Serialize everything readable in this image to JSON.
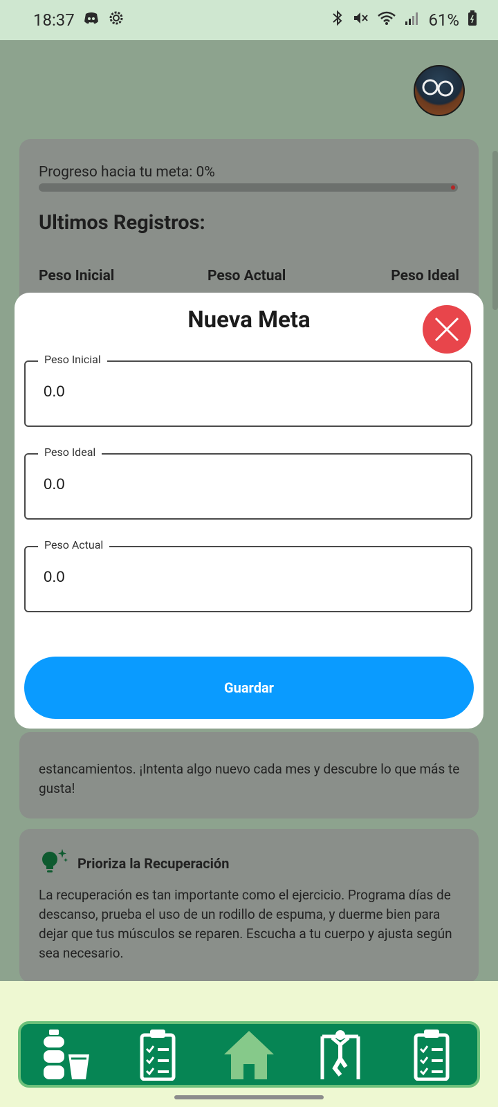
{
  "status_bar": {
    "time": "18:37",
    "battery": "61%"
  },
  "progress": {
    "label": "Progreso hacia tu meta: 0%",
    "value": 0
  },
  "records": {
    "title": "Ultimos Registros:",
    "columns": [
      "Peso Inicial",
      "Peso Actual",
      "Peso Ideal"
    ]
  },
  "card_text": "estancamientos. ¡Intenta algo nuevo cada mes y descubre lo que más te gusta!",
  "tip": {
    "title": "Prioriza la Recuperación",
    "body": "La recuperación es tan importante como el ejercicio. Programa días de descanso, prueba el uso de un rodillo de espuma, y duerme bien para dejar que tus músculos se reparen. Escucha a tu cuerpo y ajusta según sea necesario."
  },
  "modal": {
    "title": "Nueva Meta",
    "fields": [
      {
        "label": "Peso Inicial",
        "value": "0.0"
      },
      {
        "label": "Peso Ideal",
        "value": "0.0"
      },
      {
        "label": "Peso Actual",
        "value": "0.0"
      }
    ],
    "save_label": "Guardar"
  },
  "nav": {
    "items": [
      "hydration-icon",
      "checklist-icon",
      "home-icon",
      "workout-icon",
      "checklist-icon"
    ],
    "active": "home-icon"
  },
  "colors": {
    "accent": "#0a9bff",
    "close": "#e8454b",
    "nav": "#068554",
    "nav_active": "#86c98a"
  }
}
